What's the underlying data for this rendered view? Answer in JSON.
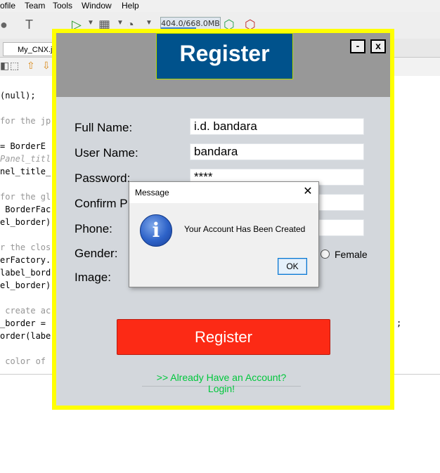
{
  "ide": {
    "menu": [
      "ofile",
      "Team",
      "Tools",
      "Window",
      "Help"
    ],
    "memory": "404.0/668.0MB",
    "memory_fraction": 0.6,
    "file_tab": "My_CNX.j",
    "code_lines": [
      "(null);",
      "",
      "for the jp",
      "",
      "= BorderE",
      "Panel_titl",
      "nel_title_",
      "",
      "for the gl",
      " BorderFac",
      "el_border)",
      "",
      "r the clos",
      "erFactory.",
      "label_bord",
      "el_border)",
      "",
      " create ac",
      "_border =",
      "order(labe",
      "",
      " color of"
    ],
    "code_right": ";"
  },
  "register": {
    "title": "Register",
    "minimize": "-",
    "close": "x",
    "labels": {
      "full_name": "Full Name:",
      "user_name": "User Name:",
      "password": "Password:",
      "confirm": "Confirm P",
      "phone": "Phone:",
      "gender": "Gender:",
      "image": "Image:"
    },
    "values": {
      "full_name": "i.d. bandara",
      "user_name": "bandara",
      "password": "****"
    },
    "female_label": "Female",
    "button": "Register",
    "login_link": ">> Already Have an Account? Login!"
  },
  "dialog": {
    "title": "Message",
    "close": "✕",
    "icon": "i",
    "message": "Your Account Has Been Created",
    "ok": "OK"
  }
}
